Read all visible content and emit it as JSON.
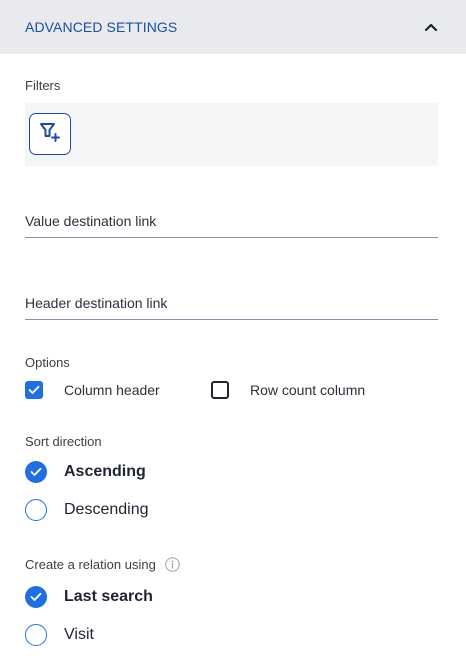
{
  "header": {
    "title": "ADVANCED SETTINGS",
    "toggle_icon": "chevron-up-icon"
  },
  "filters": {
    "label": "Filters",
    "add_icon": "filter-add-icon"
  },
  "fields": {
    "value_destination": "Value destination link",
    "header_destination": "Header destination link"
  },
  "options": {
    "label": "Options",
    "column_header": {
      "label": "Column header",
      "checked": true
    },
    "row_count_column": {
      "label": "Row count column",
      "checked": false
    }
  },
  "sort_direction": {
    "label": "Sort direction",
    "ascending": {
      "label": "Ascending",
      "selected": true
    },
    "descending": {
      "label": "Descending",
      "selected": false
    }
  },
  "relation": {
    "label": "Create a relation using",
    "info_icon": "info-icon",
    "last_search": {
      "label": "Last search",
      "selected": true
    },
    "visit": {
      "label": "Visit",
      "selected": false
    }
  },
  "colors": {
    "accent": "#1f6fe0",
    "header_text": "#1b4f9e",
    "header_bg": "#e8eaed"
  }
}
